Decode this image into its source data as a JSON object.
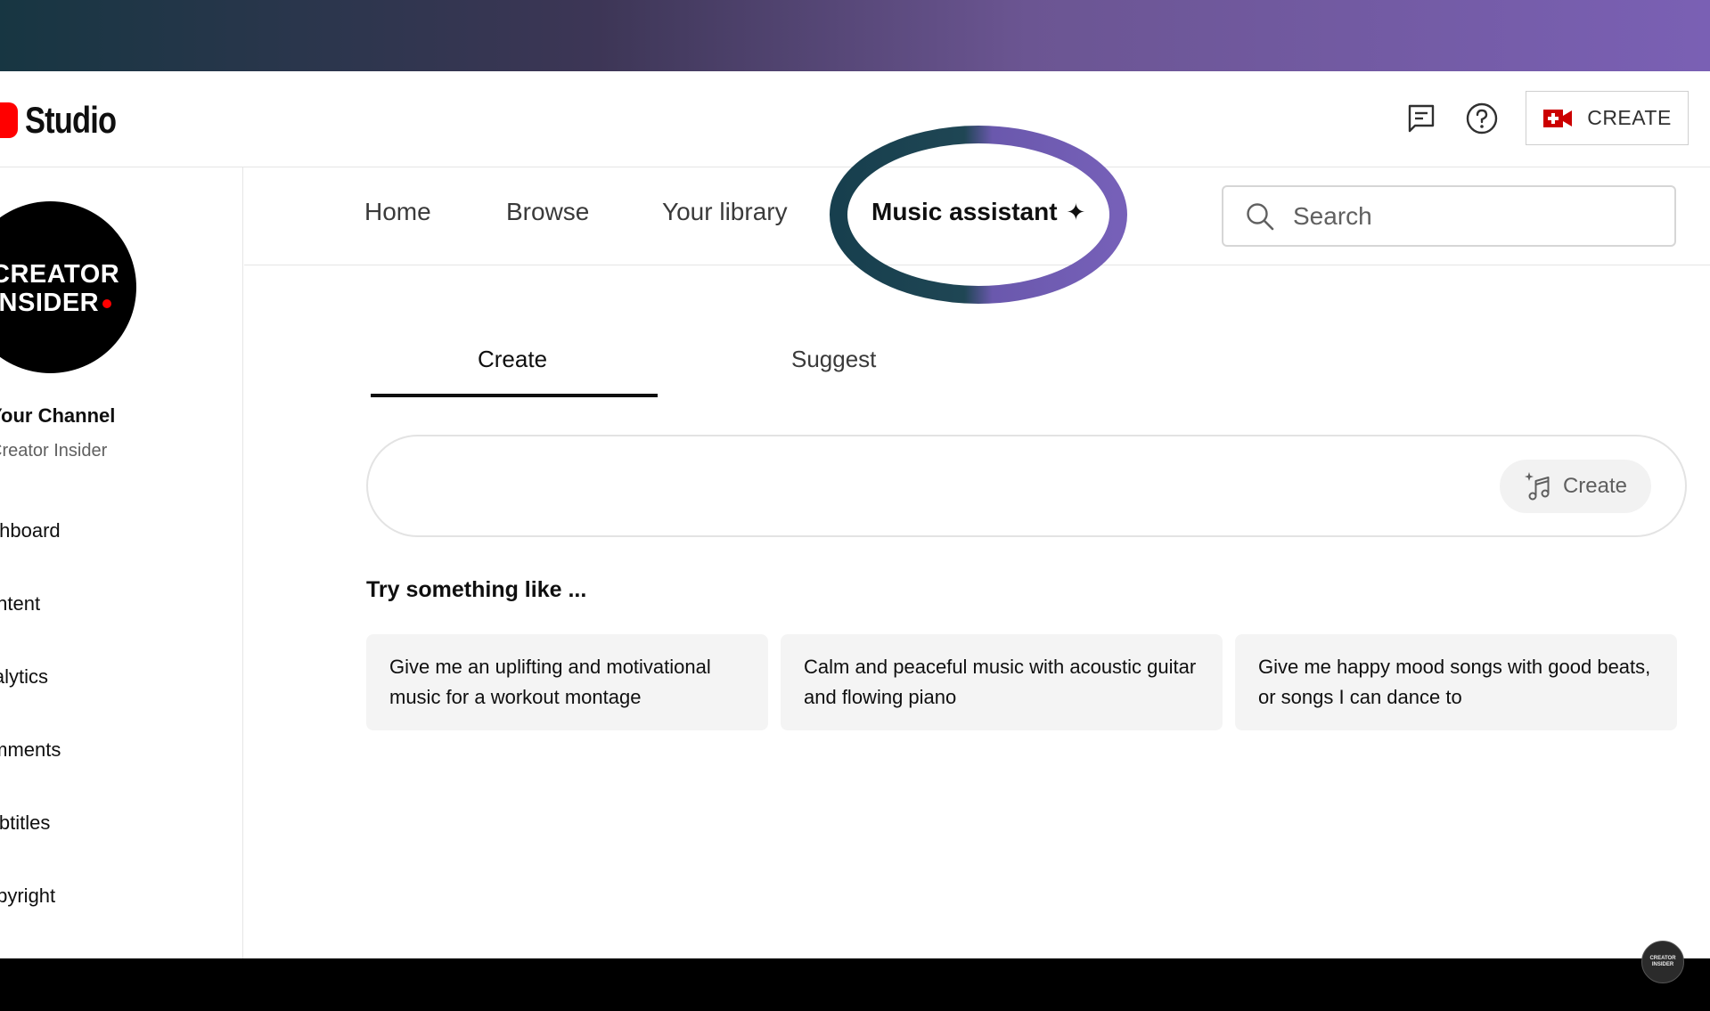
{
  "app": {
    "logo_text": "Studio",
    "create_button_label": "CREATE"
  },
  "header_icons": {
    "feedback": "feedback-icon",
    "help": "help-icon",
    "create": "video-camera-plus-icon"
  },
  "sidebar": {
    "avatar_line1": "CREATOR",
    "avatar_line2": "INSIDER",
    "channel_title": "Your Channel",
    "channel_name": "Creator Insider",
    "items": [
      {
        "label": "Dashboard"
      },
      {
        "label": "Content"
      },
      {
        "label": "Analytics"
      },
      {
        "label": "Comments"
      },
      {
        "label": "Subtitles"
      },
      {
        "label": "Copyright"
      }
    ]
  },
  "topnav": {
    "tabs": [
      {
        "label": "Home"
      },
      {
        "label": "Browse"
      },
      {
        "label": "Your library"
      },
      {
        "label": "Music assistant"
      }
    ],
    "active_tab": "Music assistant",
    "sparkle_icon": "sparkle-icon",
    "search_placeholder": "Search"
  },
  "assistant": {
    "subtabs": [
      {
        "label": "Create"
      },
      {
        "label": "Suggest"
      }
    ],
    "active_subtab": "Create",
    "prompt_value": "",
    "prompt_button_label": "Create",
    "try_label": "Try something like ...",
    "suggestions": [
      {
        "text": "Give me an uplifting and motivational music for a workout montage"
      },
      {
        "text": "Calm and peaceful music with acoustic guitar and flowing piano"
      },
      {
        "text": "Give me happy mood songs with good beats, or songs I can dance to"
      }
    ]
  },
  "watermark": {
    "line1": "CREATOR",
    "line2": "INSIDER"
  },
  "colors": {
    "brand_red": "#ff0000",
    "ring_start": "#173f4e",
    "ring_end": "#7660b8",
    "banner_start": "#173642",
    "banner_end": "#7a60b4"
  }
}
